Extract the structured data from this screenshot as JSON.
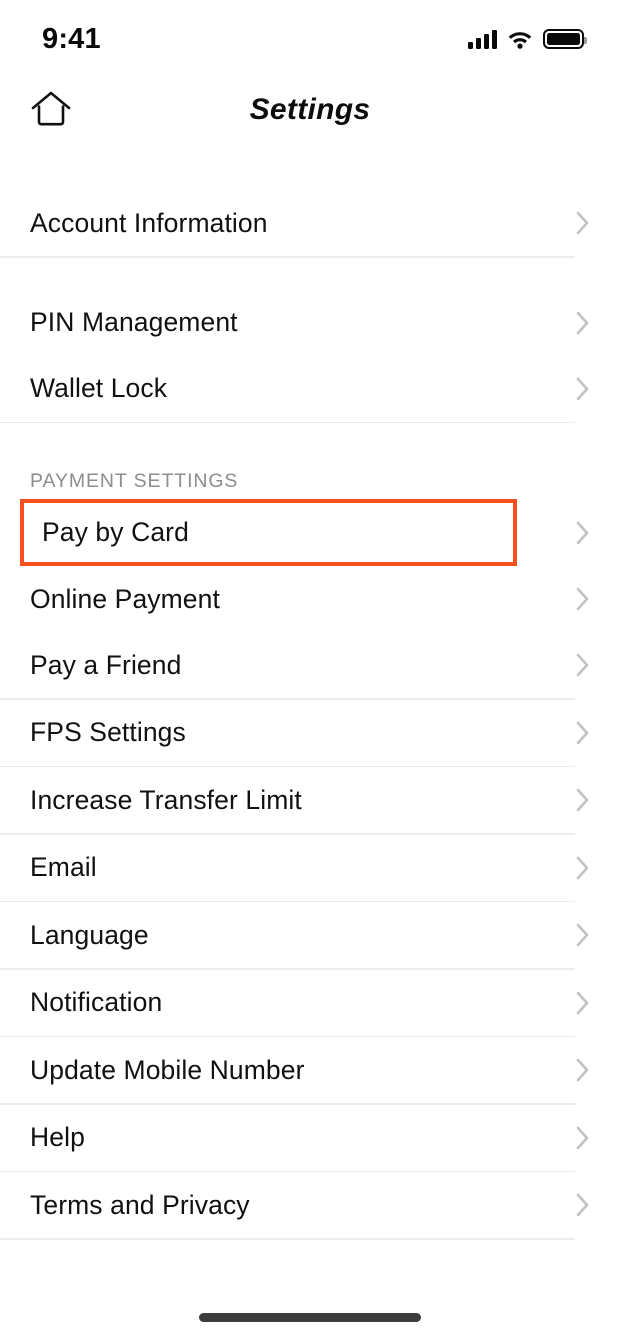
{
  "status_bar": {
    "time": "9:41",
    "signal_icon": "cellular-signal-icon",
    "wifi_icon": "wifi-icon",
    "battery_icon": "battery-full-icon"
  },
  "nav": {
    "home_icon": "home-icon",
    "title": "Settings"
  },
  "colors": {
    "highlight_border": "#F4511E",
    "divider": "#ececec",
    "chevron": "#c2c2c2",
    "section_header_text": "#8d8d8d",
    "row_text": "#111111"
  },
  "list": {
    "groups": [
      {
        "header": null,
        "items": [
          {
            "label": "Account Information",
            "chevron": "chevron-right-icon",
            "divider_after": true,
            "highlighted": false
          }
        ]
      },
      {
        "header": null,
        "items": [
          {
            "label": "PIN Management",
            "chevron": "chevron-right-icon",
            "divider_after": false,
            "highlighted": false
          },
          {
            "label": "Wallet Lock",
            "chevron": "chevron-right-icon",
            "divider_after": true,
            "highlighted": false
          }
        ]
      },
      {
        "header": "PAYMENT SETTINGS",
        "items": [
          {
            "label": "Pay by Card",
            "chevron": "chevron-right-icon",
            "divider_after": false,
            "highlighted": true
          },
          {
            "label": "Online Payment",
            "chevron": "chevron-right-icon",
            "divider_after": false,
            "highlighted": false
          },
          {
            "label": "Pay a Friend",
            "chevron": "chevron-right-icon",
            "divider_after": true,
            "highlighted": false
          },
          {
            "label": "FPS Settings",
            "chevron": "chevron-right-icon",
            "divider_after": true,
            "highlighted": false
          },
          {
            "label": "Increase Transfer Limit",
            "chevron": "chevron-right-icon",
            "divider_after": true,
            "highlighted": false
          },
          {
            "label": "Email",
            "chevron": "chevron-right-icon",
            "divider_after": true,
            "highlighted": false
          },
          {
            "label": "Language",
            "chevron": "chevron-right-icon",
            "divider_after": true,
            "highlighted": false
          },
          {
            "label": "Notification",
            "chevron": "chevron-right-icon",
            "divider_after": true,
            "highlighted": false
          },
          {
            "label": "Update Mobile Number",
            "chevron": "chevron-right-icon",
            "divider_after": true,
            "highlighted": false
          },
          {
            "label": "Help",
            "chevron": "chevron-right-icon",
            "divider_after": true,
            "highlighted": false
          },
          {
            "label": "Terms and Privacy",
            "chevron": "chevron-right-icon",
            "divider_after": true,
            "highlighted": false
          }
        ]
      }
    ]
  },
  "home_indicator": "home-indicator-bar"
}
